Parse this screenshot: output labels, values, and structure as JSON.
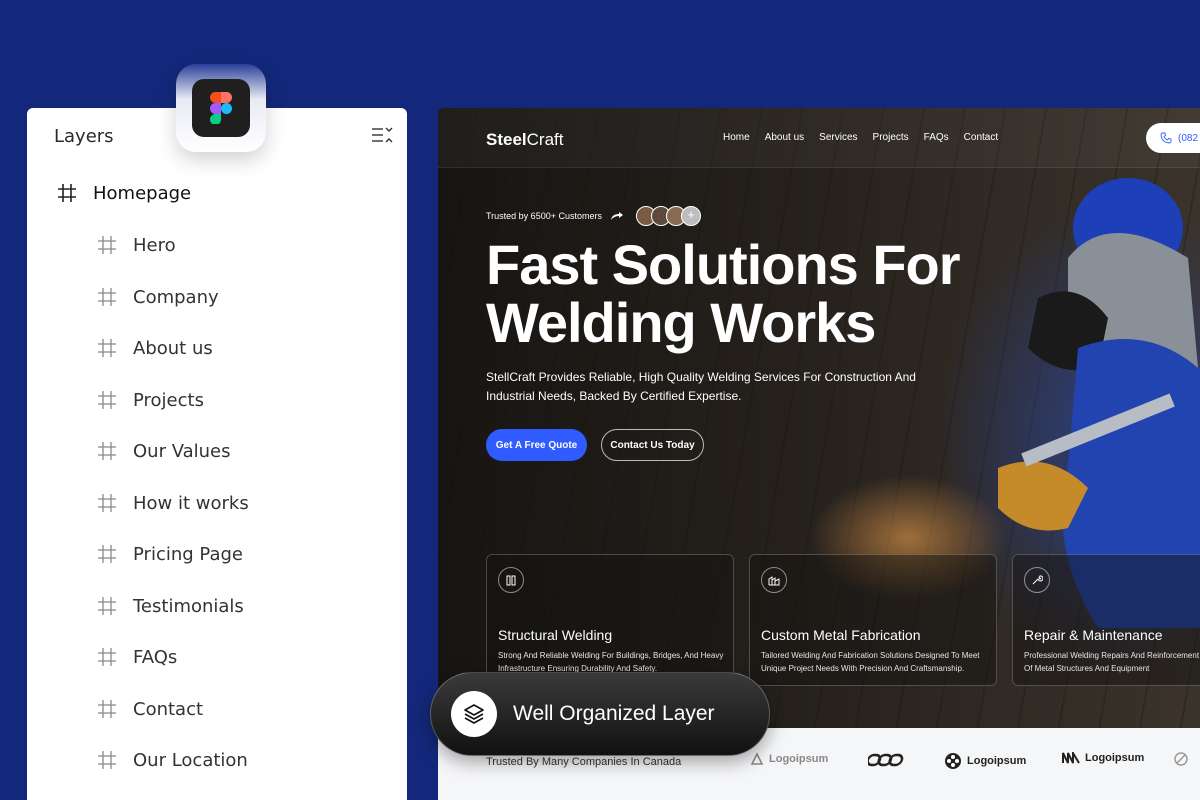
{
  "layers_panel": {
    "title": "Layers",
    "root_item": "Homepage",
    "children": [
      "Hero",
      "Company",
      "About us",
      "Projects",
      "Our Values",
      "How it works",
      "Pricing Page",
      "Testimonials",
      "FAQs",
      "Contact",
      "Our Location"
    ]
  },
  "site": {
    "brand_bold": "Steel",
    "brand_light": "Craft",
    "nav": [
      "Home",
      "About us",
      "Services",
      "Projects",
      "FAQs",
      "Contact"
    ],
    "phone_partial": "(082",
    "trusted_text": "Trusted by 6500+ Customers",
    "avatar_more": "+",
    "hero_title_line1": "Fast Solutions For",
    "hero_title_line2": "Welding Works",
    "hero_subtitle": "StellCraft Provides Reliable, High Quality Welding Services For Construction And Industrial Needs, Backed By Certified Expertise.",
    "cta_primary": "Get A Free Quote",
    "cta_secondary": "Contact Us Today",
    "services": [
      {
        "icon": "building-icon",
        "title": "Structural Welding",
        "desc": "Strong And Reliable Welding For Buildings, Bridges, And Heavy Infrastructure Ensuring Durability And Safety."
      },
      {
        "icon": "factory-icon",
        "title": "Custom Metal Fabrication",
        "desc": "Tailored Welding And Fabrication Solutions Designed To Meet Unique Project Needs With Precision And Craftsmanship."
      },
      {
        "icon": "wrench-icon",
        "title": "Repair & Maintenance",
        "desc": "Professional Welding Repairs And Reinforcement The Lifespan Of Metal Structures And Equipment"
      }
    ],
    "logos_label": "Trusted By Many Companies In Canada",
    "logos": [
      "Logoipsum",
      "",
      "Logoipsum",
      "Logoipsum",
      ""
    ]
  },
  "overlay": {
    "label": "Well Organized Layer",
    "icon": "layers-icon"
  },
  "colors": {
    "background": "#13287a",
    "accent": "#2f5bff"
  }
}
